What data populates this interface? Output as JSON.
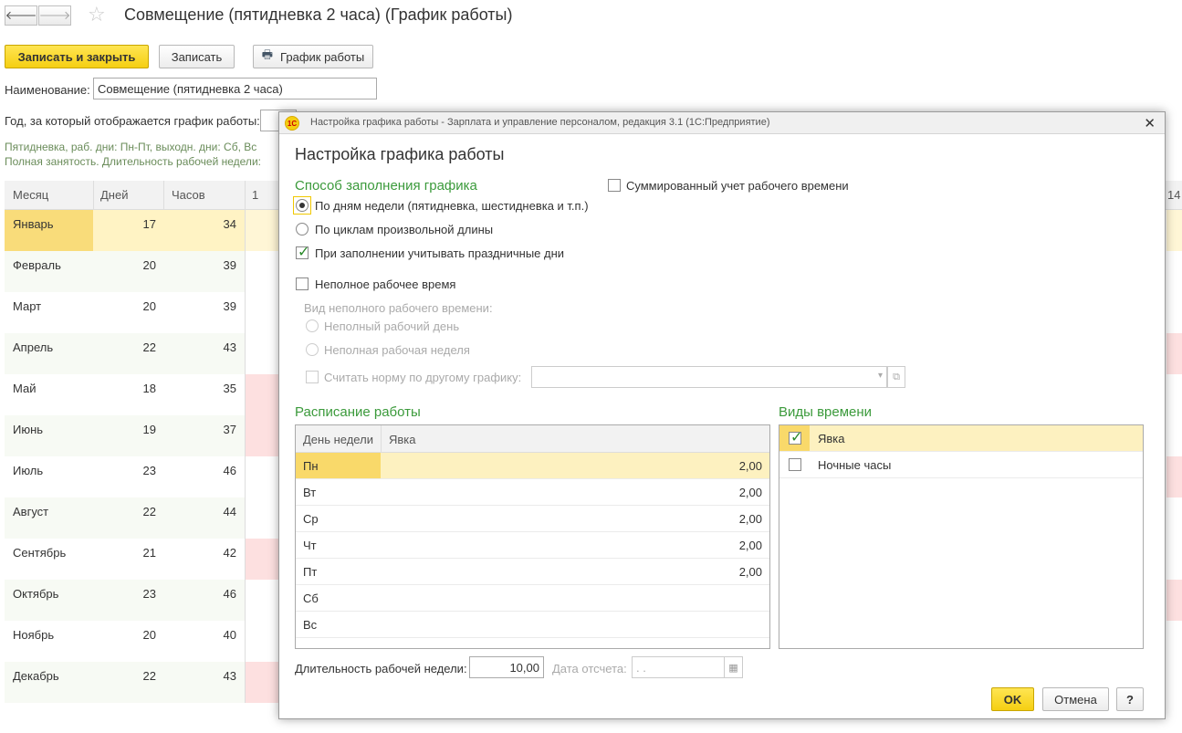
{
  "page": {
    "title": "Совмещение (пятидневка 2 часа) (График работы)",
    "buttons": {
      "save_close": "Записать и закрыть",
      "save": "Записать",
      "schedule": "График работы"
    },
    "name_label": "Наименование:",
    "name_value": "Совмещение (пятидневка 2 часа)",
    "year_label": "Год, за который отображается график работы:",
    "info_line1": "Пятидневка, раб. дни: Пн-Пт, выходн. дни: Сб, Вс",
    "info_line2": "Полная занятость. Длительность рабочей недели:",
    "day_col_1": "1",
    "day_col_14": "14"
  },
  "months_table": {
    "headers": {
      "month": "Месяц",
      "days": "Дней",
      "hours": "Часов"
    },
    "rows": [
      {
        "month": "Январь",
        "days": "17",
        "hours": "34"
      },
      {
        "month": "Февраль",
        "days": "20",
        "hours": "39"
      },
      {
        "month": "Март",
        "days": "20",
        "hours": "39"
      },
      {
        "month": "Апрель",
        "days": "22",
        "hours": "43"
      },
      {
        "month": "Май",
        "days": "18",
        "hours": "35"
      },
      {
        "month": "Июнь",
        "days": "19",
        "hours": "37"
      },
      {
        "month": "Июль",
        "days": "23",
        "hours": "46"
      },
      {
        "month": "Август",
        "days": "22",
        "hours": "44"
      },
      {
        "month": "Сентябрь",
        "days": "21",
        "hours": "42"
      },
      {
        "month": "Октябрь",
        "days": "23",
        "hours": "46"
      },
      {
        "month": "Ноябрь",
        "days": "20",
        "hours": "40"
      },
      {
        "month": "Декабрь",
        "days": "22",
        "hours": "43"
      }
    ]
  },
  "dialog": {
    "window_title": "Настройка графика работы - Зарплата и управление персоналом, редакция 3.1  (1С:Предприятие)",
    "logo": "1С",
    "heading": "Настройка графика работы",
    "fill_section": "Способ заполнения графика",
    "summed": "Суммированный учет рабочего времени",
    "by_weekdays": "По дням недели (пятидневка, шестидневка и т.п.)",
    "by_cycles": "По циклам произвольной длины",
    "holidays": "При заполнении учитывать праздничные дни",
    "part_time": "Неполное рабочее время",
    "part_kind_label": "Вид неполного рабочего времени:",
    "part_day": "Неполный рабочий день",
    "part_week": "Неполная рабочая неделя",
    "other_norm": "Считать норму по другому графику:",
    "schedule_section": "Расписание работы",
    "kinds_section": "Виды времени",
    "schedule_headers": {
      "day": "День недели",
      "presence": "Явка"
    },
    "schedule_rows": [
      {
        "day": "Пн",
        "value": "2,00"
      },
      {
        "day": "Вт",
        "value": "2,00"
      },
      {
        "day": "Ср",
        "value": "2,00"
      },
      {
        "day": "Чт",
        "value": "2,00"
      },
      {
        "day": "Пт",
        "value": "2,00"
      },
      {
        "day": "Сб",
        "value": ""
      },
      {
        "day": "Вс",
        "value": ""
      }
    ],
    "kinds": [
      {
        "name": "Явка",
        "checked": true
      },
      {
        "name": "Ночные часы",
        "checked": false
      }
    ],
    "week_length_label": "Длительность рабочей недели:",
    "week_length_value": "10,00",
    "ref_date_label": "Дата отсчета:",
    "ref_date_value": " .  .",
    "ok": "OK",
    "cancel": "Отмена",
    "help": "?"
  }
}
